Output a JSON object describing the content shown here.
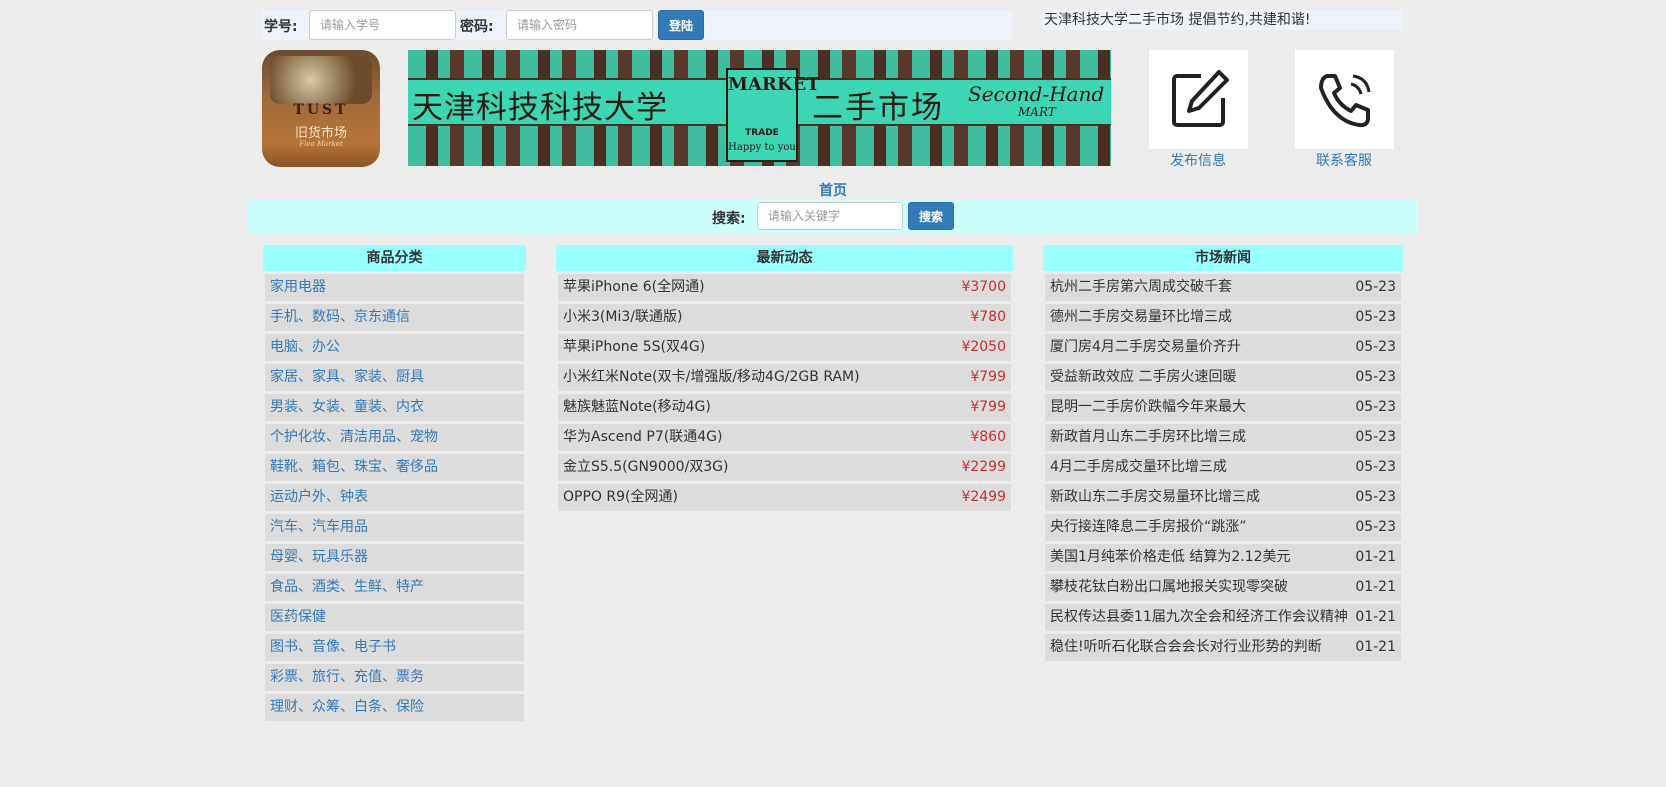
{
  "login": {
    "id_label": "学号:",
    "id_placeholder": "请输入学号",
    "pwd_label": "密码:",
    "pwd_placeholder": "请输入密码",
    "login_button": "登陆"
  },
  "slogan": "天津科技大学二手市场 提倡节约,共建和谐!",
  "logo": {
    "text": "TUST",
    "subtitle": "旧货市场",
    "subtitle2": "Flea Market"
  },
  "banner": {
    "title_left": "天津科技科技大学",
    "title_right": "二手市场",
    "market_word": "MARKET",
    "trade_word": "TRADE",
    "happy": "Happy to you",
    "english_1": "Second-Hand",
    "english_2": "MART"
  },
  "actions": {
    "publish": {
      "label": "发布信息",
      "icon": "edit-icon"
    },
    "contact": {
      "label": "联系客服",
      "icon": "phone-icon"
    }
  },
  "nav": {
    "home": "首页"
  },
  "search": {
    "label": "搜索:",
    "placeholder": "请输入关键字",
    "button": "搜索"
  },
  "categories": {
    "title": "商品分类",
    "items": [
      "家用电器",
      "手机、数码、京东通信",
      "电脑、办公",
      "家居、家具、家装、厨具",
      "男装、女装、童装、内衣",
      "个护化妆、清洁用品、宠物",
      "鞋靴、箱包、珠宝、奢侈品",
      "运动户外、钟表",
      "汽车、汽车用品",
      "母婴、玩具乐器",
      "食品、酒类、生鲜、特产",
      "医药保健",
      "图书、音像、电子书",
      "彩票、旅行、充值、票务",
      "理财、众筹、白条、保险"
    ]
  },
  "latest": {
    "title": "最新动态",
    "items": [
      {
        "name": "苹果iPhone 6(全网通)",
        "price": "¥3700"
      },
      {
        "name": "小米3(Mi3/联通版)",
        "price": "¥780"
      },
      {
        "name": "苹果iPhone 5S(双4G)",
        "price": "¥2050"
      },
      {
        "name": "小米红米Note(双卡/增强版/移动4G/2GB RAM)",
        "price": "¥799"
      },
      {
        "name": "魅族魅蓝Note(移动4G)",
        "price": "¥799"
      },
      {
        "name": "华为Ascend P7(联通4G)",
        "price": "¥860"
      },
      {
        "name": "金立S5.5(GN9000/双3G)",
        "price": "¥2299"
      },
      {
        "name": "OPPO R9(全网通)",
        "price": "¥2499"
      }
    ]
  },
  "news": {
    "title": "市场新闻",
    "items": [
      {
        "title": "杭州二手房第六周成交破千套",
        "date": "05-23"
      },
      {
        "title": "德州二手房交易量环比增三成",
        "date": "05-23"
      },
      {
        "title": "厦门房4月二手房交易量价齐升",
        "date": "05-23"
      },
      {
        "title": "受益新政效应 二手房火速回暖",
        "date": "05-23"
      },
      {
        "title": "昆明一二手房价跌幅今年来最大",
        "date": "05-23"
      },
      {
        "title": "新政首月山东二手房环比增三成",
        "date": "05-23"
      },
      {
        "title": "4月二手房成交量环比增三成",
        "date": "05-23"
      },
      {
        "title": "新政山东二手房交易量环比增三成",
        "date": "05-23"
      },
      {
        "title": "央行接连降息二手房报价“跳涨”",
        "date": "05-23"
      },
      {
        "title": "美国1月纯苯价格走低 结算为2.12美元",
        "date": "01-21"
      },
      {
        "title": "攀枝花钛白粉出口属地报关实现零突破",
        "date": "01-21"
      },
      {
        "title": "民权传达县委11届九次全会和经济工作会议精神",
        "date": "01-21"
      },
      {
        "title": "稳住!听听石化联合会会长对行业形势的判断",
        "date": "01-21"
      }
    ]
  }
}
